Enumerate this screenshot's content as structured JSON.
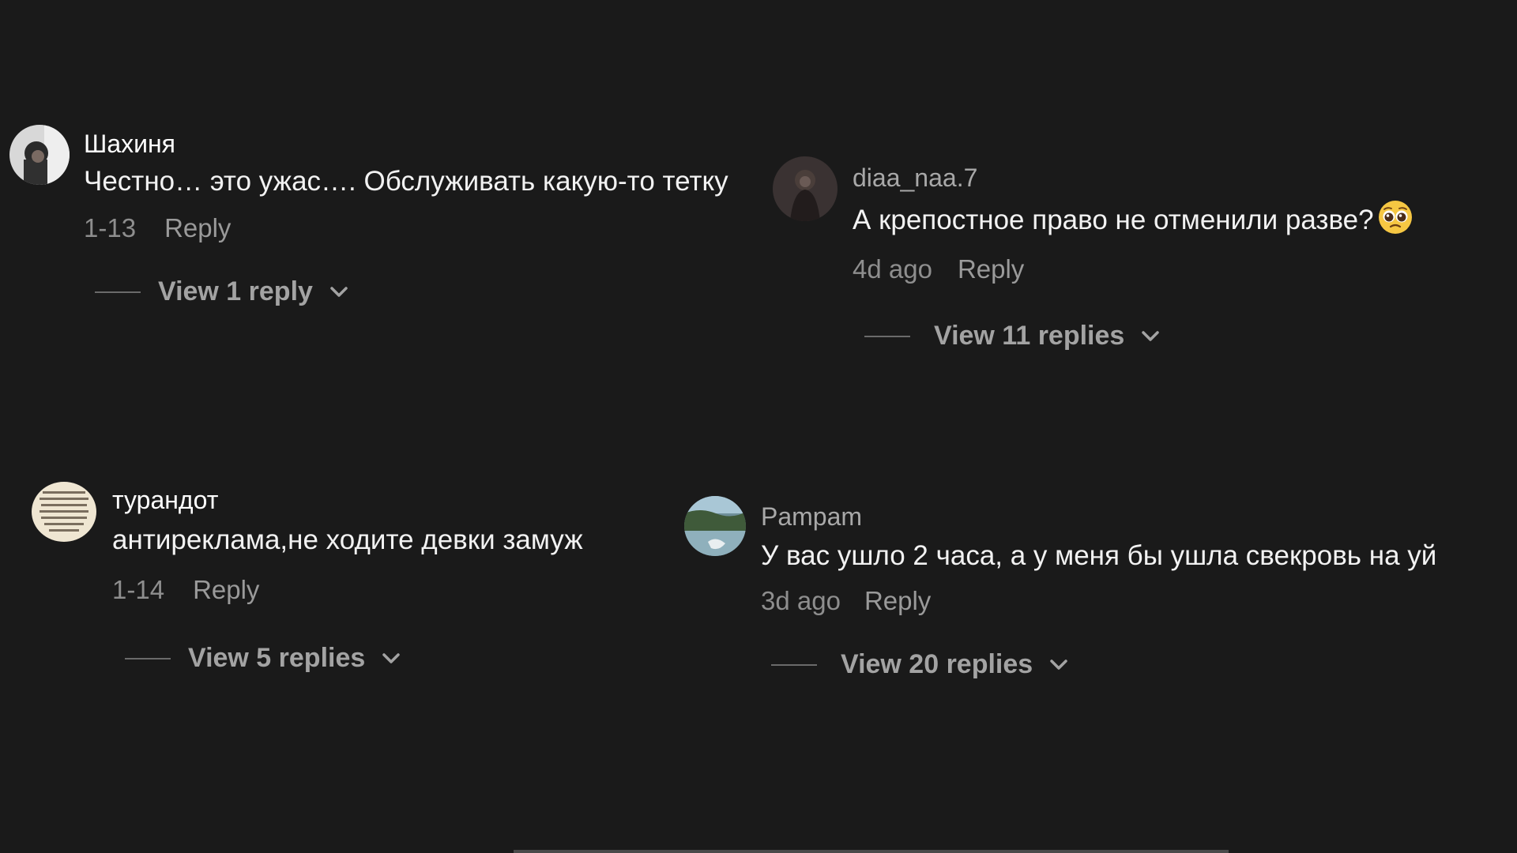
{
  "comments": [
    {
      "username": "Шахиня",
      "text": "Честно… это ужас…. Обслуживать какую-то тетку",
      "time": "1-13",
      "reply_label": "Reply",
      "view_replies": "View 1 reply",
      "username_color": "#ffffff"
    },
    {
      "username": "diaa_naa.7",
      "text": "А крепостное право не отменили разве?",
      "time": "4d ago",
      "reply_label": "Reply",
      "view_replies": "View 11 replies",
      "username_color": "#a8a8a8",
      "emoji": "pleading-face-emoji"
    },
    {
      "username": "турандот",
      "text": "антиреклама,не ходите девки замуж",
      "time": "1-14",
      "reply_label": "Reply",
      "view_replies": "View 5 replies",
      "username_color": "#ffffff"
    },
    {
      "username": "Pampam",
      "text": "У вас ушло 2 часа, а у меня бы ушла свекровь на  уй",
      "time": "3d ago",
      "reply_label": "Reply",
      "view_replies": "View 20 replies",
      "username_color": "#a8a8a8"
    }
  ],
  "icons": {
    "expand": "chevron-down-icon"
  },
  "colors": {
    "background": "#1a1a1a",
    "text": "#f2f2f2",
    "muted": "#8e8e8e"
  }
}
